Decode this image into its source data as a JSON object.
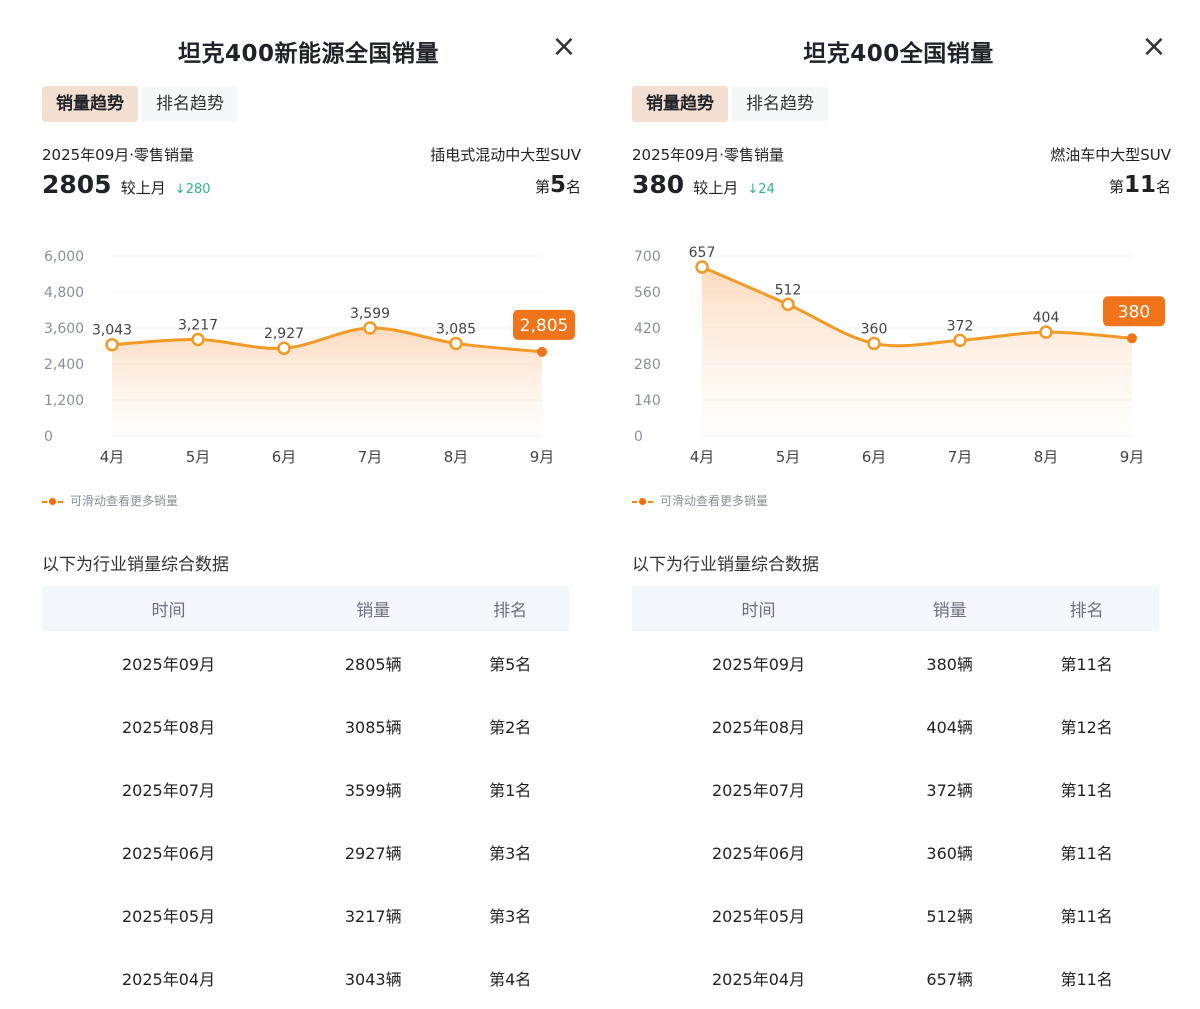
{
  "left": {
    "title": "坦克400新能源全国销量",
    "close_label": "×",
    "tabs": [
      {
        "label": "销量趋势"
      },
      {
        "label": "排名趋势"
      }
    ],
    "meta": "2025年09月·零售销量",
    "category": "插电式混动中大型SUV",
    "big_number": "2805",
    "compare_label": "较上月",
    "delta": "↓280",
    "rank_prefix": "第",
    "rank_value": "5",
    "rank_suffix": "名",
    "hint": "可滑动查看更多销量",
    "section_title": "以下为行业销量综合数据",
    "table": {
      "headers": [
        "时间",
        "销量",
        "排名"
      ],
      "rows": [
        [
          "2025年09月",
          "2805辆",
          "第5名"
        ],
        [
          "2025年08月",
          "3085辆",
          "第2名"
        ],
        [
          "2025年07月",
          "3599辆",
          "第1名"
        ],
        [
          "2025年06月",
          "2927辆",
          "第3名"
        ],
        [
          "2025年05月",
          "3217辆",
          "第3名"
        ],
        [
          "2025年04月",
          "3043辆",
          "第4名"
        ]
      ]
    }
  },
  "right": {
    "title": "坦克400全国销量",
    "close_label": "×",
    "tabs": [
      {
        "label": "销量趋势"
      },
      {
        "label": "排名趋势"
      }
    ],
    "meta": "2025年09月·零售销量",
    "category": "燃油车中大型SUV",
    "big_number": "380",
    "compare_label": "较上月",
    "delta": "↓24",
    "rank_prefix": "第",
    "rank_value": "11",
    "rank_suffix": "名",
    "hint": "可滑动查看更多销量",
    "section_title": "以下为行业销量综合数据",
    "table": {
      "headers": [
        "时间",
        "销量",
        "排名"
      ],
      "rows": [
        [
          "2025年09月",
          "380辆",
          "第11名"
        ],
        [
          "2025年08月",
          "404辆",
          "第12名"
        ],
        [
          "2025年07月",
          "372辆",
          "第11名"
        ],
        [
          "2025年06月",
          "360辆",
          "第11名"
        ],
        [
          "2025年05月",
          "512辆",
          "第11名"
        ],
        [
          "2025年04月",
          "657辆",
          "第11名"
        ]
      ]
    }
  },
  "chart_data": [
    {
      "type": "area",
      "categories": [
        "4月",
        "5月",
        "6月",
        "7月",
        "8月",
        "9月"
      ],
      "values": [
        3043,
        3217,
        2927,
        3599,
        3085,
        2805
      ],
      "value_labels": [
        "3,043",
        "3,217",
        "2,927",
        "3,599",
        "3,085",
        "2,805"
      ],
      "yticks": [
        "0",
        "1,200",
        "2,400",
        "3,600",
        "4,800",
        "6,000"
      ],
      "ylim": [
        0,
        6000
      ],
      "highlight_index": 5,
      "line_color": "#f39a26",
      "highlight_color": "#f0741a"
    },
    {
      "type": "area",
      "categories": [
        "4月",
        "5月",
        "6月",
        "7月",
        "8月",
        "9月"
      ],
      "values": [
        657,
        512,
        360,
        372,
        404,
        380
      ],
      "value_labels": [
        "657",
        "512",
        "360",
        "372",
        "404",
        "380"
      ],
      "yticks": [
        "0",
        "140",
        "280",
        "420",
        "560",
        "700"
      ],
      "ylim": [
        0,
        700
      ],
      "highlight_index": 5,
      "line_color": "#f39a26",
      "highlight_color": "#f0741a"
    }
  ]
}
